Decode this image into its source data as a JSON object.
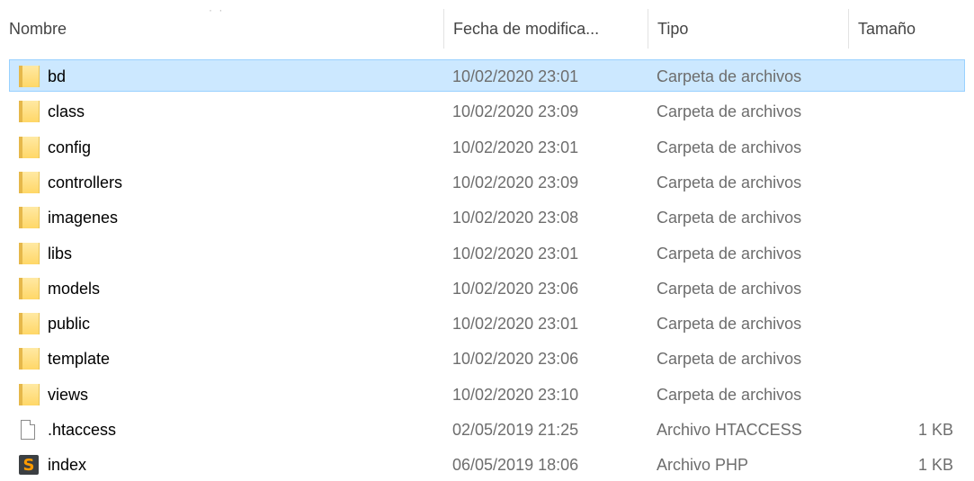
{
  "columns": {
    "name": "Nombre",
    "date": "Fecha de modifica...",
    "type": "Tipo",
    "size": "Tamaño"
  },
  "files": [
    {
      "name": "bd",
      "date": "10/02/2020 23:01",
      "type": "Carpeta de archivos",
      "size": "",
      "icon": "folder-icon",
      "selected": true
    },
    {
      "name": "class",
      "date": "10/02/2020 23:09",
      "type": "Carpeta de archivos",
      "size": "",
      "icon": "folder-icon"
    },
    {
      "name": "config",
      "date": "10/02/2020 23:01",
      "type": "Carpeta de archivos",
      "size": "",
      "icon": "folder-icon"
    },
    {
      "name": "controllers",
      "date": "10/02/2020 23:09",
      "type": "Carpeta de archivos",
      "size": "",
      "icon": "folder-icon"
    },
    {
      "name": "imagenes",
      "date": "10/02/2020 23:08",
      "type": "Carpeta de archivos",
      "size": "",
      "icon": "folder-icon"
    },
    {
      "name": "libs",
      "date": "10/02/2020 23:01",
      "type": "Carpeta de archivos",
      "size": "",
      "icon": "folder-icon"
    },
    {
      "name": "models",
      "date": "10/02/2020 23:06",
      "type": "Carpeta de archivos",
      "size": "",
      "icon": "folder-icon"
    },
    {
      "name": "public",
      "date": "10/02/2020 23:01",
      "type": "Carpeta de archivos",
      "size": "",
      "icon": "folder-icon"
    },
    {
      "name": "template",
      "date": "10/02/2020 23:06",
      "type": "Carpeta de archivos",
      "size": "",
      "icon": "folder-icon"
    },
    {
      "name": "views",
      "date": "10/02/2020 23:10",
      "type": "Carpeta de archivos",
      "size": "",
      "icon": "folder-icon"
    },
    {
      "name": ".htaccess",
      "date": "02/05/2019 21:25",
      "type": "Archivo HTACCESS",
      "size": "1 KB",
      "icon": "file-icon"
    },
    {
      "name": "index",
      "date": "06/05/2019 18:06",
      "type": "Archivo PHP",
      "size": "1 KB",
      "icon": "php-icon"
    }
  ],
  "colors": {
    "selection_bg": "#cce8ff",
    "selection_border": "#99d1ff",
    "folder": "#ffd767",
    "php_accent": "#ff9b00"
  }
}
